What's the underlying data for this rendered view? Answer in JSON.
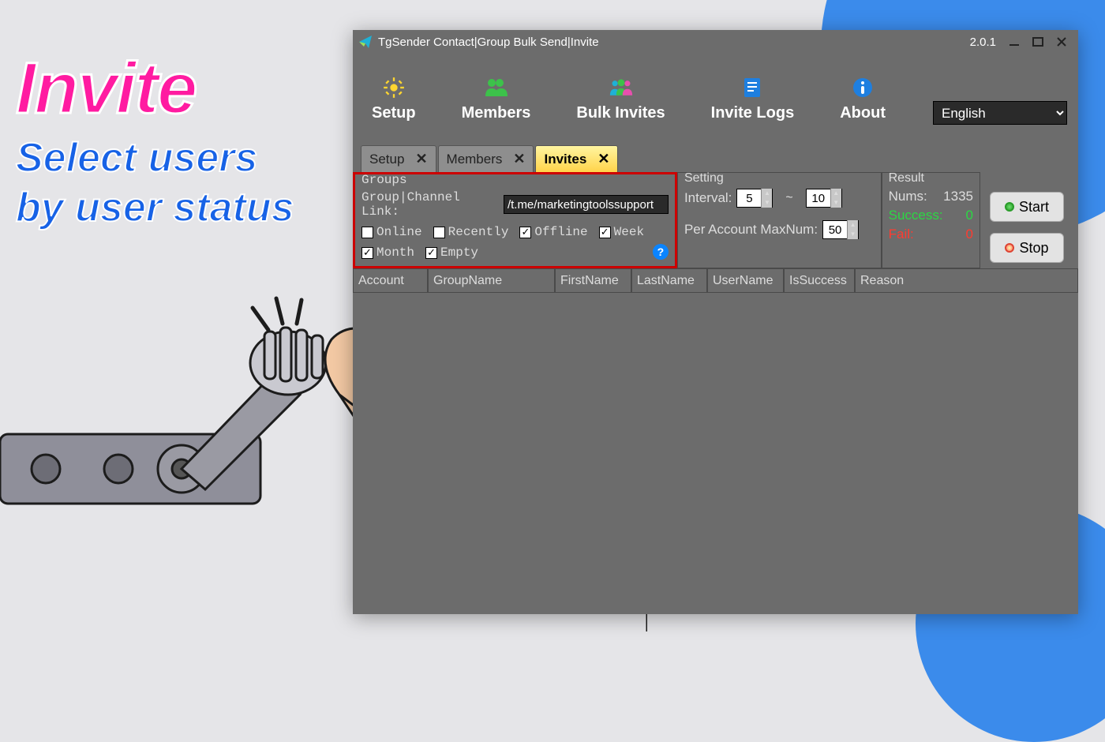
{
  "hero": {
    "title": "Invite",
    "sub1": "Select users",
    "sub2": "by user status"
  },
  "window": {
    "title": "TgSender Contact|Group Bulk Send|Invite",
    "version": "2.0.1"
  },
  "nav": {
    "setup": "Setup",
    "members": "Members",
    "bulk_invites": "Bulk Invites",
    "invite_logs": "Invite Logs",
    "about": "About",
    "language": "English"
  },
  "docTabs": {
    "setup": "Setup",
    "members": "Members",
    "invites": "Invites"
  },
  "groups": {
    "legend": "Groups",
    "link_label": "Group|Channel Link:",
    "link_value": "/t.me/marketingtoolssupport",
    "online": "Online",
    "recently": "Recently",
    "offline": "Offline",
    "week": "Week",
    "month": "Month",
    "empty": "Empty",
    "checked": {
      "online": false,
      "recently": false,
      "offline": true,
      "week": true,
      "month": true,
      "empty": true
    }
  },
  "setting": {
    "legend": "Setting",
    "interval_label": "Interval:",
    "interval_min": "5",
    "interval_sep": "~",
    "interval_max": "10",
    "per_account_label": "Per Account MaxNum:",
    "per_account_value": "50"
  },
  "result": {
    "legend": "Result",
    "nums_label": "Nums:",
    "nums_value": "1335",
    "success_label": "Success:",
    "success_value": "0",
    "fail_label": "Fail:",
    "fail_value": "0"
  },
  "actions": {
    "start": "Start",
    "stop": "Stop"
  },
  "table": {
    "cols": [
      "Account",
      "GroupName",
      "FirstName",
      "LastName",
      "UserName",
      "IsSuccess",
      "Reason"
    ],
    "widths": [
      95,
      161,
      97,
      96,
      97,
      90,
      280
    ]
  }
}
